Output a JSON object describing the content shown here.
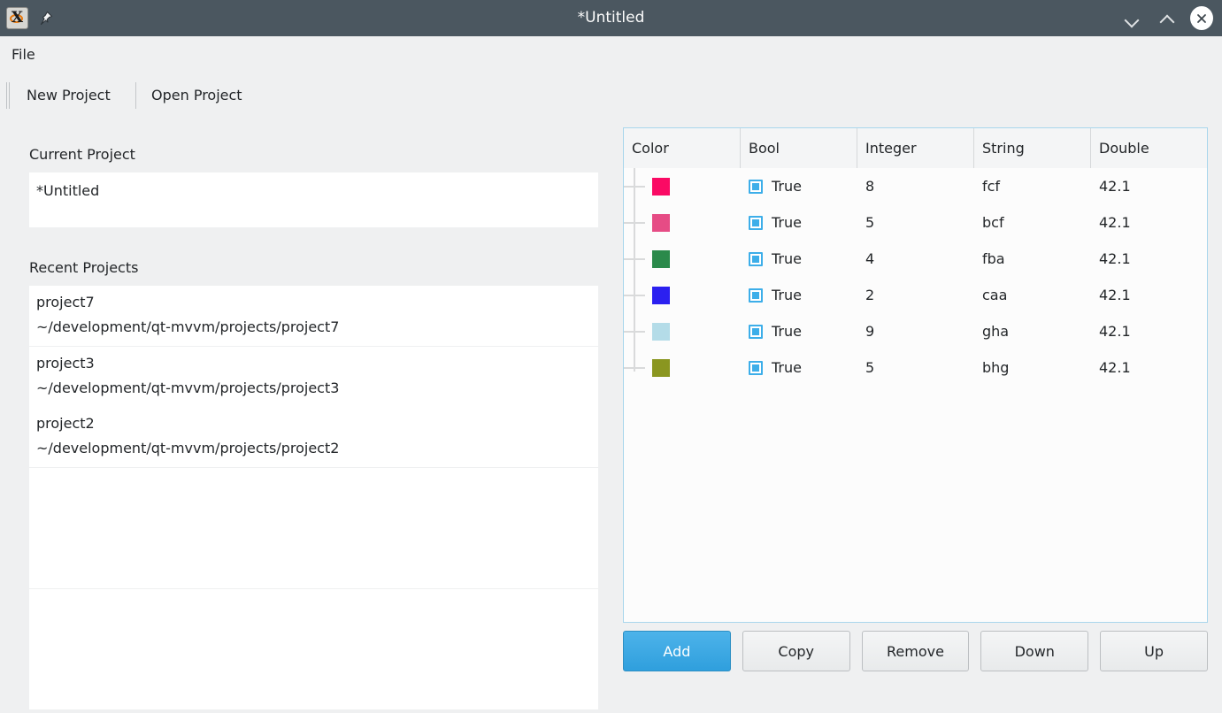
{
  "window": {
    "title": "*Untitled",
    "app_icon": "xfce-app-icon",
    "pin_icon": "pin-icon",
    "minimize_icon": "chevron-down-icon",
    "maximize_icon": "chevron-up-icon",
    "close_icon": "close-icon"
  },
  "menubar": {
    "items": [
      {
        "label": "File"
      }
    ]
  },
  "toolbar": {
    "grip": "drag-handle",
    "buttons": [
      {
        "label": "New Project"
      },
      {
        "label": "Open Project"
      }
    ]
  },
  "left_panel": {
    "current_project": {
      "label": "Current Project",
      "value": "*Untitled"
    },
    "recent_projects": {
      "label": "Recent Projects",
      "items": [
        {
          "name": "project7",
          "path": "~/development/qt-mvvm/projects/project7"
        },
        {
          "name": "project3",
          "path": "~/development/qt-mvvm/projects/project3"
        },
        {
          "name": "project2",
          "path": "~/development/qt-mvvm/projects/project2"
        },
        {
          "name": "",
          "path": ""
        },
        {
          "name": "",
          "path": ""
        },
        {
          "name": "",
          "path": ""
        },
        {
          "name": "",
          "path": ""
        }
      ]
    }
  },
  "table": {
    "columns": [
      "Color",
      "Bool",
      "Integer",
      "String",
      "Double"
    ],
    "rows": [
      {
        "color": "#fa0a64",
        "bool": "True",
        "integer": "8",
        "string": "fcf",
        "double": "42.1"
      },
      {
        "color": "#e64c85",
        "bool": "True",
        "integer": "5",
        "string": "bcf",
        "double": "42.1"
      },
      {
        "color": "#2b8a4b",
        "bool": "True",
        "integer": "4",
        "string": "fba",
        "double": "42.1"
      },
      {
        "color": "#2b20f0",
        "bool": "True",
        "integer": "2",
        "string": "caa",
        "double": "42.1"
      },
      {
        "color": "#b4dce8",
        "bool": "True",
        "integer": "9",
        "string": "gha",
        "double": "42.1"
      },
      {
        "color": "#8a9620",
        "bool": "True",
        "integer": "5",
        "string": "bhg",
        "double": "42.1"
      }
    ]
  },
  "action_buttons": [
    {
      "label": "Add",
      "primary": true
    },
    {
      "label": "Copy",
      "primary": false
    },
    {
      "label": "Remove",
      "primary": false
    },
    {
      "label": "Down",
      "primary": false
    },
    {
      "label": "Up",
      "primary": false
    }
  ],
  "colors": {
    "titlebar_bg": "#4b5760",
    "window_bg": "#eff0f1",
    "accent": "#3daee9",
    "table_border": "#a9d6ec"
  }
}
